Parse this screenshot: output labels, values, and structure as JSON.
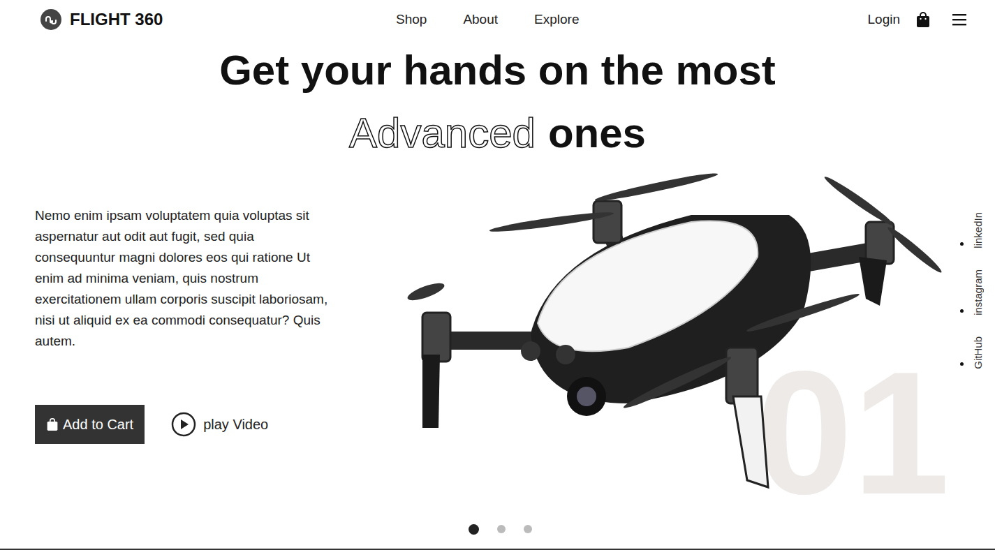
{
  "brand": {
    "name": "FLIGHT 360"
  },
  "nav": {
    "links": [
      {
        "label": "Shop"
      },
      {
        "label": "About"
      },
      {
        "label": "Explore"
      }
    ],
    "login": "Login"
  },
  "hero": {
    "title_line1": "Get your hands on the most",
    "title_outline": "Advanced",
    "title_rest": "ones",
    "description": "Nemo enim ipsam voluptatem quia voluptas sit aspernatur aut odit aut fugit, sed quia consequuntur magni dolores eos qui ratione Ut enim ad minima veniam, quis nostrum exercitationem ullam corporis suscipit laboriosam, nisi ut aliquid ex ea commodi consequatur? Quis autem.",
    "add_to_cart": "Add to Cart",
    "play_video": "play Video",
    "slide_number": "01"
  },
  "socials": [
    {
      "label": "linkedIn"
    },
    {
      "label": "instagram"
    },
    {
      "label": "GitHub"
    }
  ],
  "slides": [
    {
      "selected": true
    },
    {
      "selected": false
    },
    {
      "selected": false
    }
  ]
}
